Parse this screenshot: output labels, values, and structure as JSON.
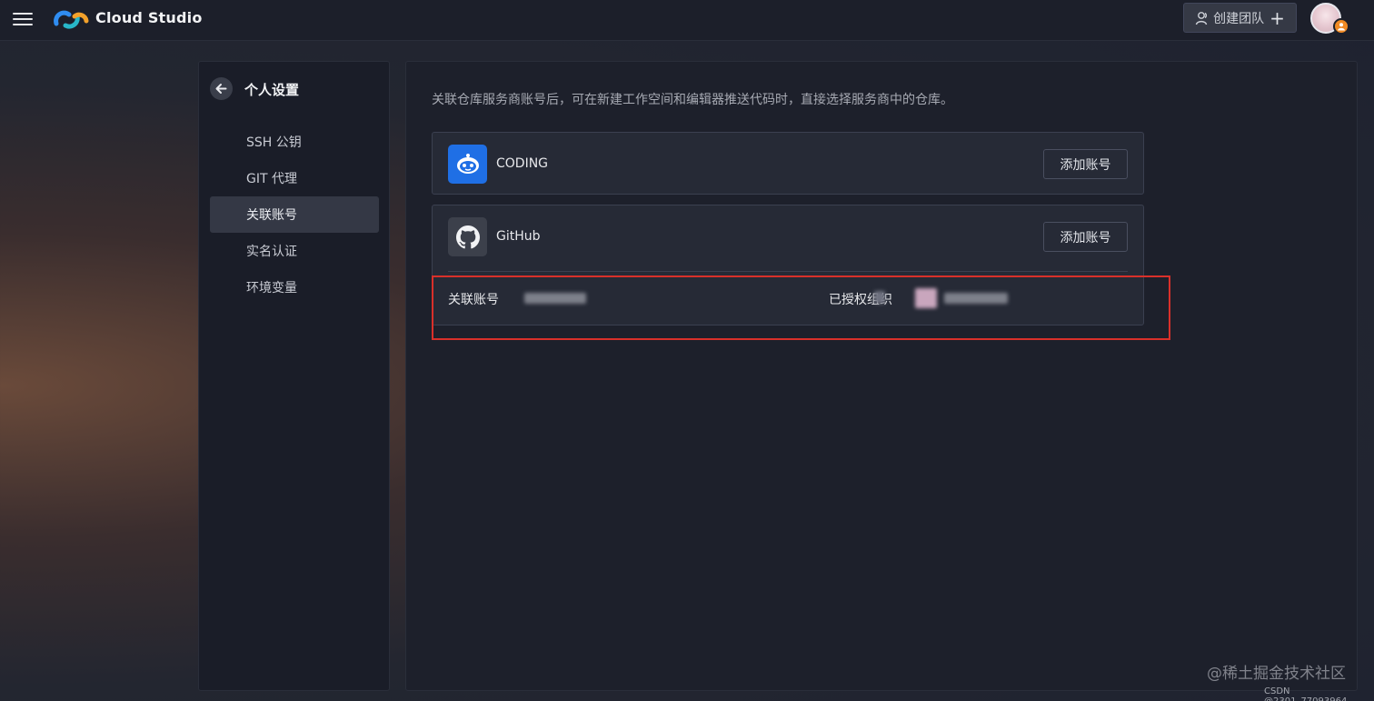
{
  "topbar": {
    "brand": "Cloud Studio",
    "create_team_label": "创建团队"
  },
  "sidebar": {
    "title": "个人设置",
    "items": [
      {
        "label": "SSH 公钥",
        "active": false
      },
      {
        "label": "GIT 代理",
        "active": false
      },
      {
        "label": "关联账号",
        "active": true
      },
      {
        "label": "实名认证",
        "active": false
      },
      {
        "label": "环境变量",
        "active": false
      }
    ]
  },
  "main": {
    "description": "关联仓库服务商账号后，可在新建工作空间和编辑器推送代码时，直接选择服务商中的仓库。",
    "providers": [
      {
        "name": "CODING",
        "icon": "coding-icon",
        "button": "添加账号"
      },
      {
        "name": "GitHub",
        "icon": "github-icon",
        "button": "添加账号"
      }
    ],
    "linked_account_label": "关联账号",
    "authorized_org_label": "已授权组织"
  },
  "watermark": "@稀土掘金技术社区",
  "credit": "CSDN @2301_77093964",
  "colors": {
    "accent_highlight": "#d9302a",
    "coding_blue": "#1f6fe5",
    "panel_bg": "#1d202b"
  }
}
